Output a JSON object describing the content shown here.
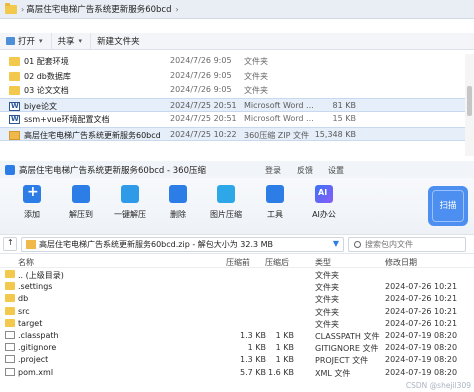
{
  "explorer": {
    "breadcrumb_separator": "›",
    "current_folder": "高层住宅电梯广告系统更新服务60bcd",
    "toolbar": {
      "open_label": "打开",
      "share_label": "共享",
      "new_folder_label": "新建文件夹"
    },
    "files": [
      {
        "name": "01 配套环境",
        "date": "2024/7/26 9:05",
        "type": "文件夹",
        "size": "",
        "icon": "folder-icon",
        "selected": false
      },
      {
        "name": "02 db数据库",
        "date": "2024/7/26 9:05",
        "type": "文件夹",
        "size": "",
        "icon": "folder-icon",
        "selected": false
      },
      {
        "name": "03 论文文档",
        "date": "2024/7/26 9:05",
        "type": "文件夹",
        "size": "",
        "icon": "folder-icon",
        "selected": false
      },
      {
        "name": "biye论文",
        "date": "2024/7/25 20:51",
        "type": "Microsoft Word ...",
        "size": "81 KB",
        "icon": "word-icon",
        "selected": true
      },
      {
        "name": "ssm+vue环境配置文档",
        "date": "2024/7/25 20:51",
        "type": "Microsoft Word ...",
        "size": "15 KB",
        "icon": "word-icon",
        "selected": false
      },
      {
        "name": "高层住宅电梯广告系统更新服务60bcd",
        "date": "2024/7/25 10:22",
        "type": "360压缩 ZIP 文件",
        "size": "15,348 KB",
        "icon": "zip-icon",
        "selected": true
      }
    ]
  },
  "zip": {
    "title": "高层住宅电梯广告系统更新服务60bcd - 360压缩",
    "menu": {
      "login": "登录",
      "feedback": "反馈",
      "settings": "设置"
    },
    "ribbon": {
      "add": "添加",
      "extract_to": "解压到",
      "one_click_extract": "一键解压",
      "delete": "删除",
      "image_compress": "图片压缩",
      "tools": "工具",
      "ai_office": "AI办公",
      "scan": "扫描"
    },
    "path": "高层住宅电梯广告系统更新服务60bcd.zip - 解包大小为 32.3 MB",
    "search_placeholder": "搜索包内文件",
    "columns": {
      "name": "名称",
      "compressed": "压缩前",
      "original": "压缩后",
      "type": "类型",
      "modified": "修改日期"
    },
    "entries": [
      {
        "name": ".. (上级目录)",
        "csize": "",
        "osize": "",
        "type": "文件夹",
        "mtime": "",
        "icon": "folder-icon"
      },
      {
        "name": ".settings",
        "csize": "",
        "osize": "",
        "type": "文件夹",
        "mtime": "2024-07-26 10:21",
        "icon": "folder-icon"
      },
      {
        "name": "db",
        "csize": "",
        "osize": "",
        "type": "文件夹",
        "mtime": "2024-07-26 10:21",
        "icon": "folder-icon"
      },
      {
        "name": "src",
        "csize": "",
        "osize": "",
        "type": "文件夹",
        "mtime": "2024-07-26 10:21",
        "icon": "folder-icon"
      },
      {
        "name": "target",
        "csize": "",
        "osize": "",
        "type": "文件夹",
        "mtime": "2024-07-26 10:21",
        "icon": "folder-icon"
      },
      {
        "name": ".classpath",
        "csize": "1.3 KB",
        "osize": "1 KB",
        "type": "CLASSPATH 文件",
        "mtime": "2024-07-19 08:20",
        "icon": "file-icon"
      },
      {
        "name": ".gitignore",
        "csize": "1 KB",
        "osize": "1 KB",
        "type": "GITIGNORE 文件",
        "mtime": "2024-07-19 08:20",
        "icon": "file-icon"
      },
      {
        "name": ".project",
        "csize": "1.3 KB",
        "osize": "1 KB",
        "type": "PROJECT 文件",
        "mtime": "2024-07-19 08:20",
        "icon": "file-icon"
      },
      {
        "name": "pom.xml",
        "csize": "5.7 KB",
        "osize": "1.6 KB",
        "type": "XML 文件",
        "mtime": "2024-07-19 08:20",
        "icon": "file-icon"
      }
    ],
    "watermark": "CSDN @shejil309"
  }
}
